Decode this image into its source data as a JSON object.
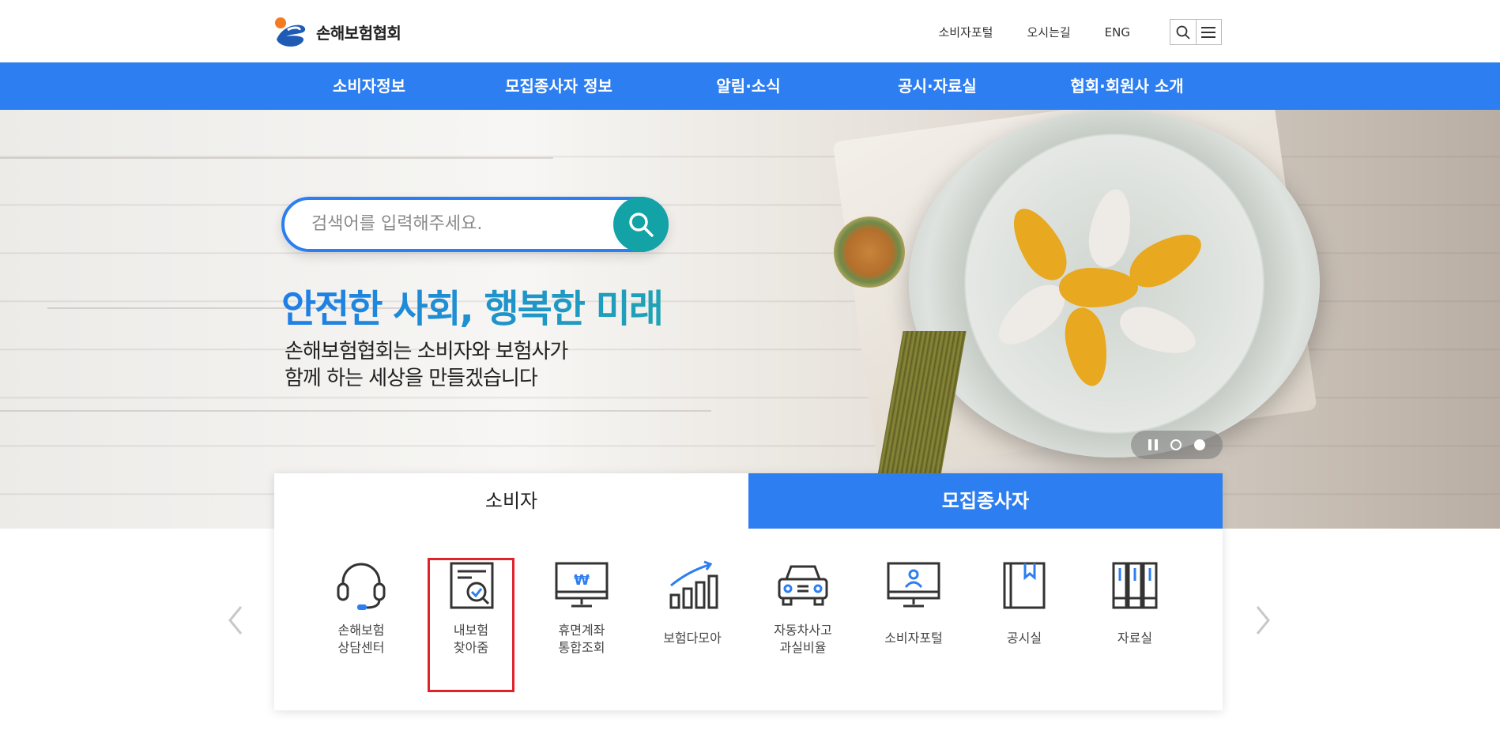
{
  "header": {
    "logo_text": "손해보험협회",
    "links": [
      "소비자포털",
      "오시는길",
      "ENG"
    ]
  },
  "nav": {
    "items": [
      "소비자정보",
      "모집종사자 정보",
      "알림·소식",
      "공시·자료실",
      "협회·회원사 소개"
    ]
  },
  "hero": {
    "search_placeholder": "검색어를 입력해주세요.",
    "slogan": "안전한 사회, 행복한 미래",
    "sub_line1": "손해보험협회는 소비자와 보험사가",
    "sub_line2": "함께 하는 세상을 만들겠습니다",
    "slides_total": 2,
    "slide_active": 2
  },
  "tabs": {
    "consumer": "소비자",
    "agent": "모집종사자"
  },
  "services": [
    {
      "line1": "손해보험",
      "line2": "상담센터",
      "icon": "headset-icon"
    },
    {
      "line1": "내보험",
      "line2": "찾아줌",
      "icon": "document-search-icon"
    },
    {
      "line1": "휴면계좌",
      "line2": "통합조회",
      "icon": "monitor-won-icon"
    },
    {
      "line1": "보험다모아",
      "line2": "",
      "icon": "growth-chart-icon"
    },
    {
      "line1": "자동차사고",
      "line2": "과실비율",
      "icon": "car-icon"
    },
    {
      "line1": "소비자포털",
      "line2": "",
      "icon": "monitor-user-icon"
    },
    {
      "line1": "공시실",
      "line2": "",
      "icon": "book-icon"
    },
    {
      "line1": "자료실",
      "line2": "",
      "icon": "binders-icon"
    }
  ],
  "colors": {
    "primary": "#2d7ef0",
    "search_button": "#13a3a6",
    "highlight": "#e0232b"
  }
}
